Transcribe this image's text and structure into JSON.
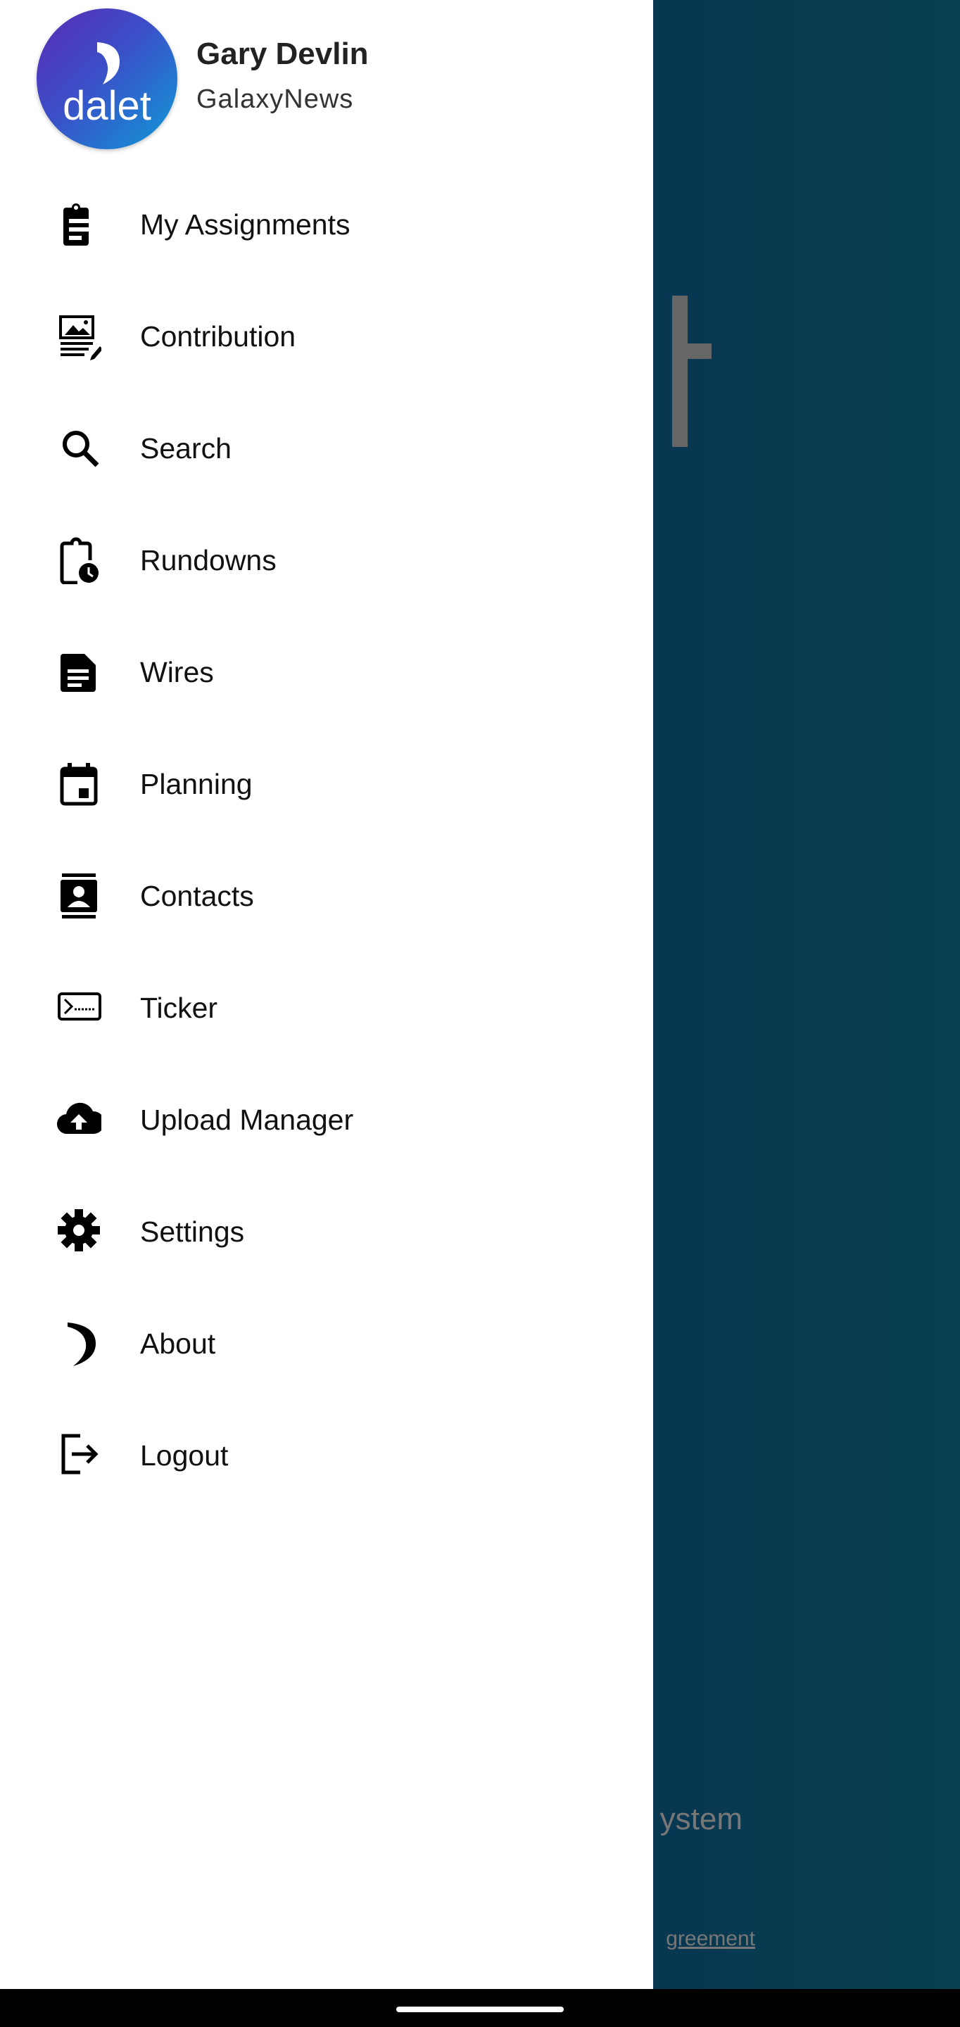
{
  "background": {
    "title_fragment": "ystem",
    "link_fragment": "greement"
  },
  "header": {
    "logo_text": "dalet",
    "user_name": "Gary Devlin",
    "organization": "GalaxyNews"
  },
  "menu": {
    "items": [
      {
        "label": "My Assignments",
        "icon": "clipboard-icon"
      },
      {
        "label": "Contribution",
        "icon": "image-article-edit-icon"
      },
      {
        "label": "Search",
        "icon": "search-icon"
      },
      {
        "label": "Rundowns",
        "icon": "clipboard-clock-icon"
      },
      {
        "label": "Wires",
        "icon": "document-icon"
      },
      {
        "label": "Planning",
        "icon": "calendar-icon"
      },
      {
        "label": "Contacts",
        "icon": "contact-card-icon"
      },
      {
        "label": "Ticker",
        "icon": "ticker-icon"
      },
      {
        "label": "Upload Manager",
        "icon": "cloud-upload-icon"
      },
      {
        "label": "Settings",
        "icon": "gear-icon"
      },
      {
        "label": "About",
        "icon": "dalet-logo-icon"
      },
      {
        "label": "Logout",
        "icon": "logout-icon"
      }
    ]
  },
  "colors": {
    "accent_start": "#5a2bb5",
    "accent_end": "#0f9ad6",
    "backdrop": "#0b2e52"
  }
}
